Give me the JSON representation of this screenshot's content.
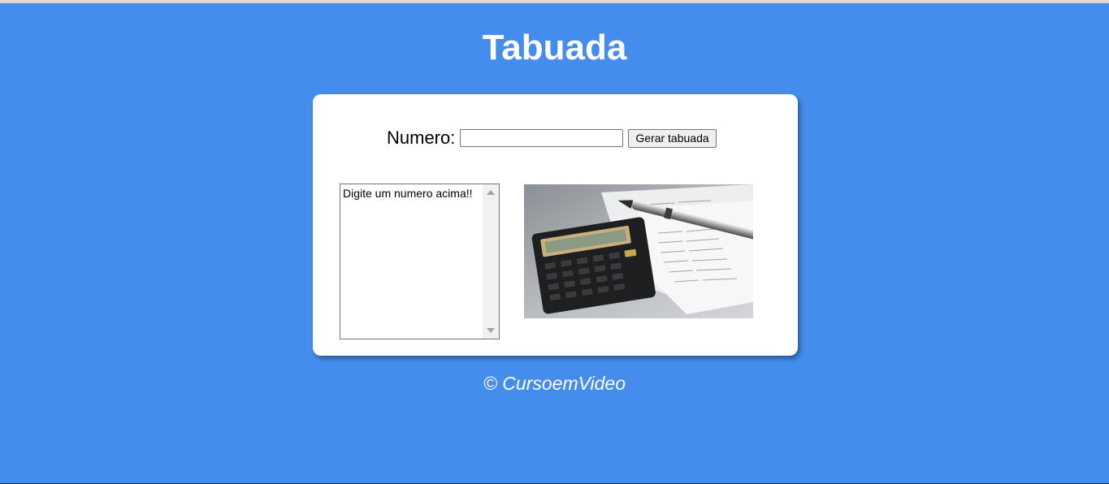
{
  "page": {
    "title": "Tabuada",
    "footer": "© CursoemVideo"
  },
  "form": {
    "label": "Numero:",
    "input_value": "",
    "button_label": "Gerar tabuada"
  },
  "result": {
    "options": [
      "Digite um numero acima!!"
    ]
  },
  "image": {
    "subject": "calculator-with-pen-and-papers"
  },
  "colors": {
    "background": "#448ded",
    "card": "#ffffff",
    "text": "#ffffff"
  }
}
